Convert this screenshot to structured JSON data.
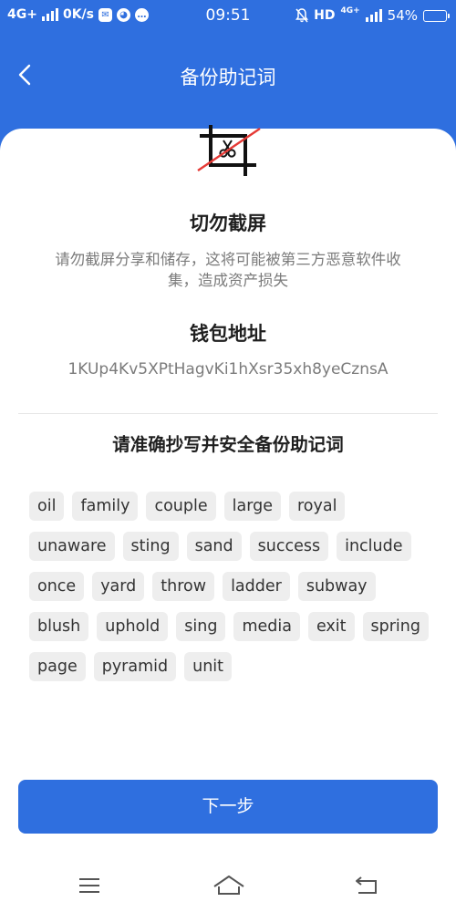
{
  "status_bar": {
    "network": "4G+",
    "speed": "0K/s",
    "time": "09:51",
    "hd": "HD",
    "net_type": "4G+",
    "battery": "54%",
    "battery_level": 0.54
  },
  "header": {
    "title": "备份助记词",
    "back_icon": "chevron-left-icon"
  },
  "warning": {
    "icon": "no-screenshot-icon",
    "title": "切勿截屏",
    "text": "请勿截屏分享和储存，这将可能被第三方恶意软件收集，造成资产损失"
  },
  "wallet": {
    "address_title": "钱包地址",
    "address": "1KUp4Kv5XPtHagvKi1hXsr35xh8yeCznsA"
  },
  "mnemonic": {
    "title": "请准确抄写并安全备份助记词",
    "words": [
      "oil",
      "family",
      "couple",
      "large",
      "royal",
      "unaware",
      "sting",
      "sand",
      "success",
      "include",
      "once",
      "yard",
      "throw",
      "ladder",
      "subway",
      "blush",
      "uphold",
      "sing",
      "media",
      "exit",
      "spring",
      "page",
      "pyramid",
      "unit"
    ]
  },
  "actions": {
    "next_label": "下一步"
  },
  "colors": {
    "primary": "#2f6fdf",
    "chip_bg": "#eeeeee",
    "muted_text": "#7b7b7b",
    "warning_strike": "#e53935"
  },
  "navbar": {
    "items": [
      "menu-icon",
      "home-icon",
      "back-icon"
    ]
  }
}
